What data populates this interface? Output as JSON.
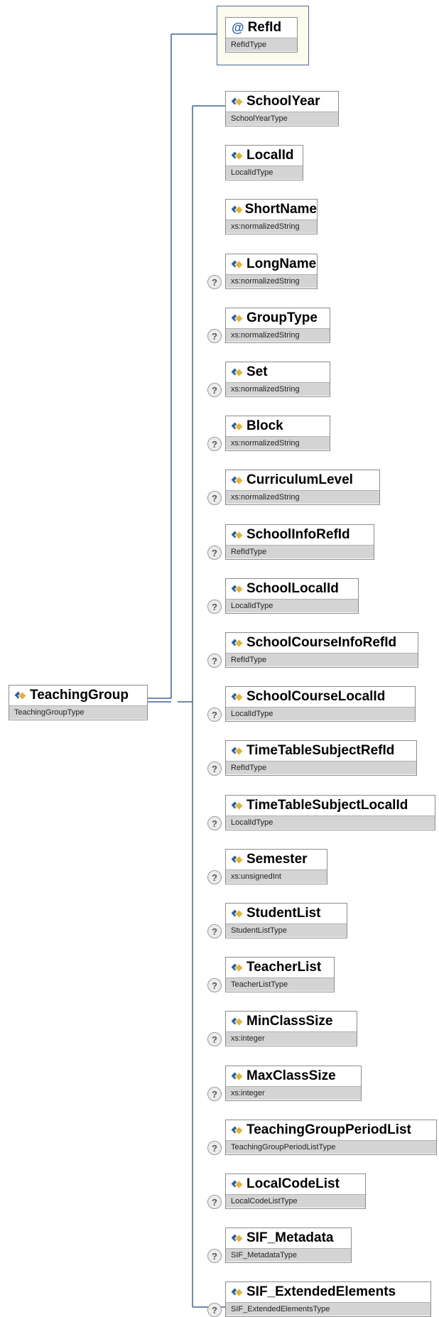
{
  "root": {
    "name": "TeachingGroup",
    "type": "TeachingGroupType"
  },
  "attribute": {
    "name": "RefId",
    "type": "RefIdType",
    "icon": "attribute-at-icon"
  },
  "optional_marker": "?",
  "colors": {
    "connector": "#3e6492",
    "type_band": "#d4d4d4",
    "attr_frame_bg": "#fbfbee"
  },
  "elements": [
    {
      "name": "SchoolYear",
      "type": "SchoolYearType",
      "optional": false
    },
    {
      "name": "LocalId",
      "type": "LocalIdType",
      "optional": false
    },
    {
      "name": "ShortName",
      "type": "xs:normalizedString",
      "optional": false
    },
    {
      "name": "LongName",
      "type": "xs:normalizedString",
      "optional": true
    },
    {
      "name": "GroupType",
      "type": "xs:normalizedString",
      "optional": true
    },
    {
      "name": "Set",
      "type": "xs:normalizedString",
      "optional": true
    },
    {
      "name": "Block",
      "type": "xs:normalizedString",
      "optional": true
    },
    {
      "name": "CurriculumLevel",
      "type": "xs:normalizedString",
      "optional": true
    },
    {
      "name": "SchoolInfoRefId",
      "type": "RefIdType",
      "optional": true
    },
    {
      "name": "SchoolLocalId",
      "type": "LocalIdType",
      "optional": true
    },
    {
      "name": "SchoolCourseInfoRefId",
      "type": "RefIdType",
      "optional": true
    },
    {
      "name": "SchoolCourseLocalId",
      "type": "LocalIdType",
      "optional": true
    },
    {
      "name": "TimeTableSubjectRefId",
      "type": "RefIdType",
      "optional": true
    },
    {
      "name": "TimeTableSubjectLocalId",
      "type": "LocalIdType",
      "optional": true
    },
    {
      "name": "Semester",
      "type": "xs:unsignedInt",
      "optional": true
    },
    {
      "name": "StudentList",
      "type": "StudentListType",
      "optional": true
    },
    {
      "name": "TeacherList",
      "type": "TeacherListType",
      "optional": true
    },
    {
      "name": "MinClassSize",
      "type": "xs:integer",
      "optional": true
    },
    {
      "name": "MaxClassSize",
      "type": "xs:integer",
      "optional": true
    },
    {
      "name": "TeachingGroupPeriodList",
      "type": "TeachingGroupPeriodListType",
      "optional": true
    },
    {
      "name": "LocalCodeList",
      "type": "LocalCodeListType",
      "optional": true
    },
    {
      "name": "SIF_Metadata",
      "type": "SIF_MetadataType",
      "optional": true
    },
    {
      "name": "SIF_ExtendedElements",
      "type": "SIF_ExtendedElementsType",
      "optional": true
    }
  ]
}
